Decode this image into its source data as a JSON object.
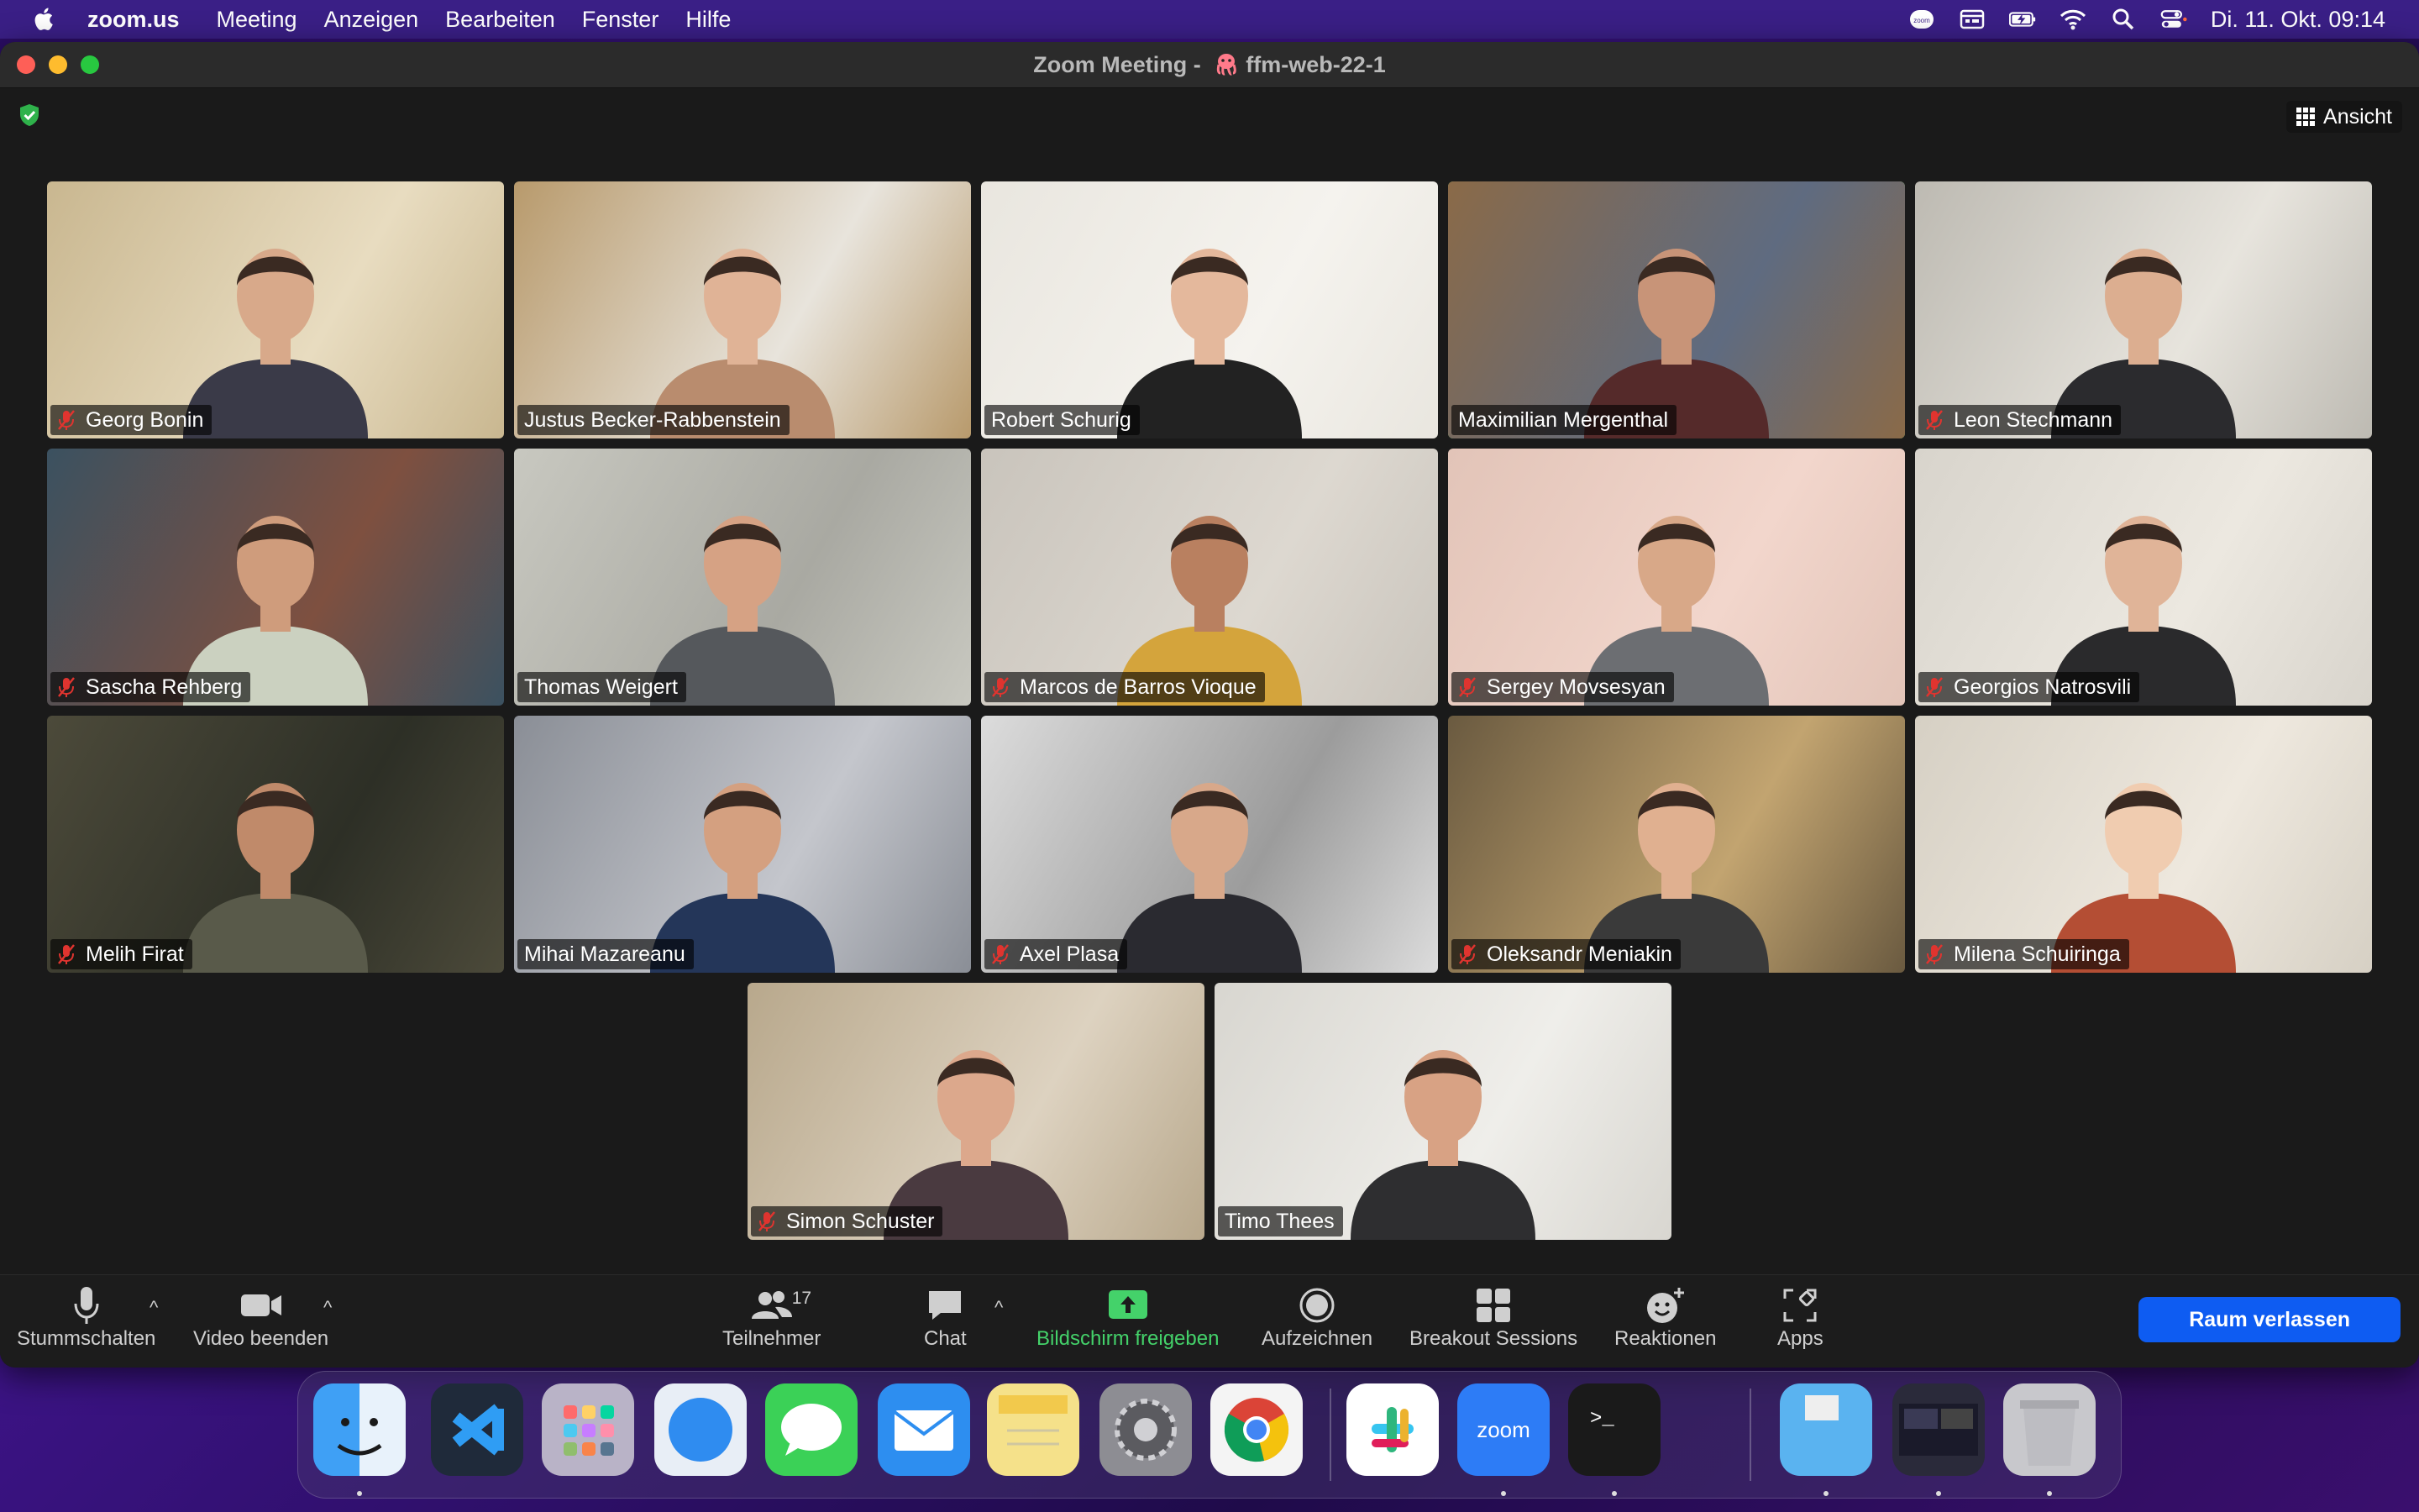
{
  "menubar": {
    "app": "zoom.us",
    "items": [
      "Meeting",
      "Anzeigen",
      "Bearbeiten",
      "Fenster",
      "Hilfe"
    ],
    "clock": "Di. 11. Okt.  09:14",
    "status_icons": [
      "zoom-status-icon",
      "calendar-icon",
      "battery-charging-icon",
      "wifi-icon",
      "search-icon",
      "control-center-icon"
    ]
  },
  "window": {
    "title_prefix": "Zoom Meeting - ",
    "title_meeting": "ffm-web-22-1",
    "view_label": "Ansicht"
  },
  "participants": [
    {
      "name": "Georg Bonin",
      "muted": true
    },
    {
      "name": "Justus Becker-Rabbenstein",
      "muted": false
    },
    {
      "name": "Robert Schurig",
      "muted": false
    },
    {
      "name": "Maximilian Mergenthal",
      "muted": false,
      "speaking": true
    },
    {
      "name": "Leon Stechmann",
      "muted": true
    },
    {
      "name": "Sascha Rehberg",
      "muted": true
    },
    {
      "name": "Thomas Weigert",
      "muted": false
    },
    {
      "name": "Marcos de Barros Vioque",
      "muted": true
    },
    {
      "name": "Sergey Movsesyan",
      "muted": true
    },
    {
      "name": "Georgios Natrosvili",
      "muted": true
    },
    {
      "name": "Melih Firat",
      "muted": true
    },
    {
      "name": "Mihai Mazareanu",
      "muted": false
    },
    {
      "name": "Axel Plasa",
      "muted": true
    },
    {
      "name": "Oleksandr Meniakin",
      "muted": true
    },
    {
      "name": "Milena Schuiringa",
      "muted": true
    },
    {
      "name": "Simon Schuster",
      "muted": true
    },
    {
      "name": "Timo Thees",
      "muted": false
    }
  ],
  "controls": {
    "mute": "Stummschalten",
    "video": "Video beenden",
    "participants": "Teilnehmer",
    "participants_count": "17",
    "chat": "Chat",
    "share": "Bildschirm freigeben",
    "record": "Aufzeichnen",
    "breakout": "Breakout Sessions",
    "reactions": "Reaktionen",
    "apps": "Apps",
    "leave": "Raum verlassen"
  },
  "dock": [
    "Finder",
    "Visual Studio Code",
    "Launchpad",
    "Safari",
    "Messages",
    "Mail",
    "Notes",
    "System Preferences",
    "Chrome",
    "Slack",
    "Zoom",
    "Terminal",
    "Downloads",
    "Window preview",
    "Trash"
  ],
  "colors": {
    "share_green": "#44d26a",
    "leave_blue": "#0e5cf2",
    "active_speaker": "#6ad96a",
    "muted_red": "#e0342f"
  }
}
